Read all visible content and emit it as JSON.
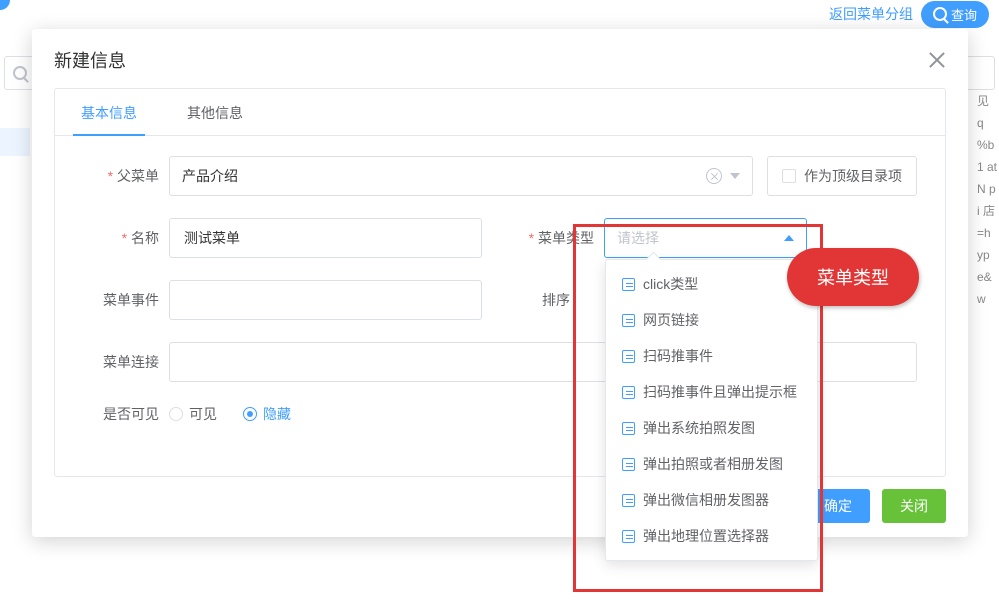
{
  "background": {
    "back_link": "返回菜单分组",
    "query_btn": "查询",
    "search_placeholder": "",
    "right_noise": "见 q %b 1 at  N  pi 店 =h yp e& w"
  },
  "modal": {
    "title": "新建信息",
    "tabs": {
      "basic": "基本信息",
      "other": "其他信息"
    },
    "labels": {
      "parent_menu": "父菜单",
      "name": "名称",
      "menu_type": "菜单类型",
      "menu_event": "菜单事件",
      "sort": "排序",
      "menu_link": "菜单连接",
      "visible": "是否可见"
    },
    "values": {
      "parent_menu": "产品介绍",
      "name": "测试菜单",
      "menu_event": "",
      "sort": "",
      "menu_link": ""
    },
    "placeholders": {
      "menu_type": "请选择"
    },
    "top_level_checkbox": "作为顶级目录项",
    "visible_options": {
      "show": "可见",
      "hide": "隐藏"
    },
    "visible_selected": "hide",
    "menu_type_options": [
      "click类型",
      "网页链接",
      "扫码推事件",
      "扫码推事件且弹出提示框",
      "弹出系统拍照发图",
      "弹出拍照或者相册发图",
      "弹出微信相册发图器",
      "弹出地理位置选择器"
    ],
    "buttons": {
      "ok": "确定",
      "close": "关闭"
    }
  },
  "annotation": {
    "label": "菜单类型"
  }
}
